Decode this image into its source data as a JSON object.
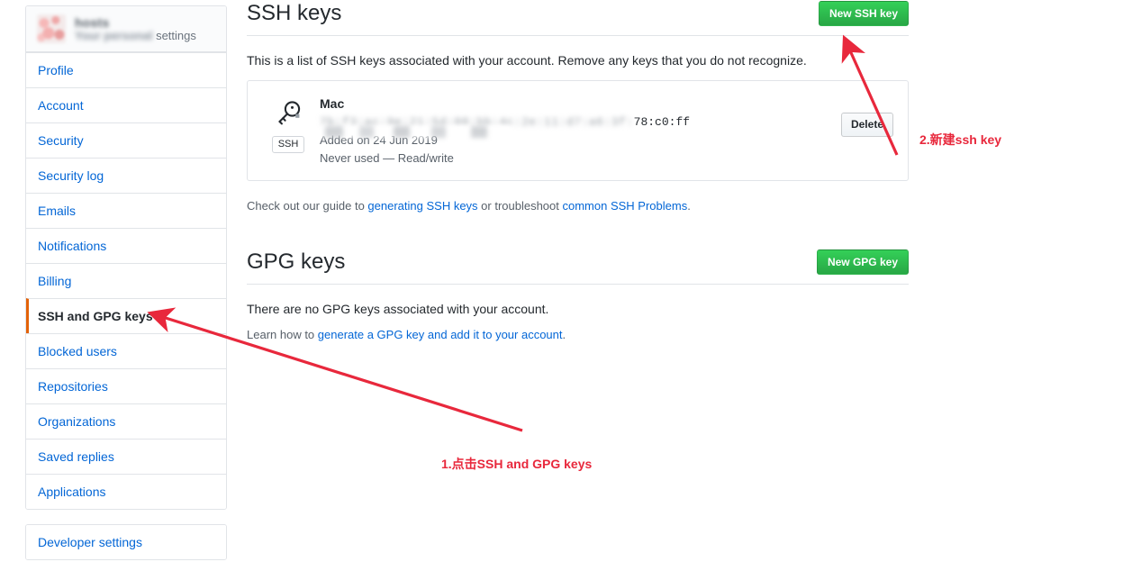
{
  "sidebar": {
    "profile": {
      "name_blurred": "hosts",
      "subtitle_blurred": "Your personal",
      "subtitle_suffix": "settings",
      "avatar_icon": "user-avatar-blurred"
    },
    "items": [
      {
        "label": "Profile",
        "active": false
      },
      {
        "label": "Account",
        "active": false
      },
      {
        "label": "Security",
        "active": false
      },
      {
        "label": "Security log",
        "active": false
      },
      {
        "label": "Emails",
        "active": false
      },
      {
        "label": "Notifications",
        "active": false
      },
      {
        "label": "Billing",
        "active": false
      },
      {
        "label": "SSH and GPG keys",
        "active": true
      },
      {
        "label": "Blocked users",
        "active": false
      },
      {
        "label": "Repositories",
        "active": false
      },
      {
        "label": "Organizations",
        "active": false
      },
      {
        "label": "Saved replies",
        "active": false
      },
      {
        "label": "Applications",
        "active": false
      }
    ],
    "developer_settings": "Developer settings"
  },
  "ssh_section": {
    "title": "SSH keys",
    "new_key_button": "New SSH key",
    "description": "This is a list of SSH keys associated with your account. Remove any keys that you do not recognize.",
    "key": {
      "icon": "key-icon",
      "badge": "SSH",
      "title": "Mac",
      "fingerprint_blurred": "7b:f3:ac:9e:21:5d:08:bb:4c:2e:11:d7:a6:3f:",
      "fingerprint_visible": "78:c0:ff",
      "added": "Added on 24 Jun 2019",
      "usage": "Never used — Read/write",
      "delete_button": "Delete"
    },
    "guide": {
      "prefix": "Check out our guide to ",
      "link1": "generating SSH keys",
      "middle": " or troubleshoot ",
      "link2": "common SSH Problems",
      "suffix": "."
    }
  },
  "gpg_section": {
    "title": "GPG keys",
    "new_key_button": "New GPG key",
    "empty_text": "There are no GPG keys associated with your account.",
    "learn": {
      "prefix": "Learn how to ",
      "link": "generate a GPG key and add it to your account",
      "suffix": "."
    }
  },
  "annotations": {
    "color": "#e8283c",
    "step1": "1.点击SSH and GPG keys",
    "step2": "2.新建ssh key"
  }
}
